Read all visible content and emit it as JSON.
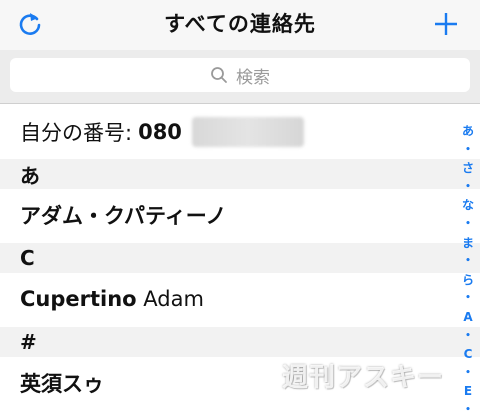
{
  "header": {
    "title": "すべての連絡先",
    "refresh_icon": "refresh-icon",
    "add_icon": "plus-icon",
    "accent_color": "#1a7bf0"
  },
  "search": {
    "placeholder": "検索",
    "icon": "search-icon"
  },
  "my_number": {
    "label": "自分の番号:",
    "value": "080"
  },
  "sections": [
    {
      "letter": "あ",
      "contacts": [
        {
          "bold": "アダム・クパティーノ",
          "rest": ""
        }
      ]
    },
    {
      "letter": "C",
      "contacts": [
        {
          "bold": "Cupertino",
          "rest": " Adam"
        }
      ]
    },
    {
      "letter": "#",
      "contacts": [
        {
          "bold": "英須スゥ",
          "rest": ""
        }
      ]
    }
  ],
  "index": [
    "あ",
    "•",
    "さ",
    "•",
    "な",
    "•",
    "ま",
    "•",
    "ら",
    "•",
    "A",
    "•",
    "C",
    "•",
    "E",
    "•"
  ],
  "watermark": "週刊アスキー"
}
